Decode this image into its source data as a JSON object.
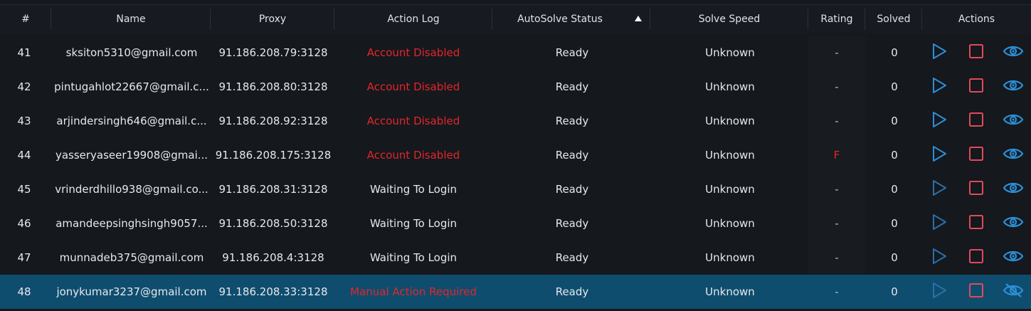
{
  "header": {
    "idx": "#",
    "name": "Name",
    "proxy": "Proxy",
    "action_log": "Action Log",
    "status": "AutoSolve Status",
    "speed": "Solve Speed",
    "rating": "Rating",
    "solved": "Solved",
    "actions": "Actions"
  },
  "colors": {
    "error": "#e3262b",
    "play": "#2a8fd8",
    "stop": "#e04a5a",
    "eye": "#2a8fd8",
    "selected_row": "#0f4d6e"
  },
  "rows": [
    {
      "idx": "41",
      "name": "sksiton5310@gmail.com",
      "proxy": "91.186.208.79:3128",
      "log": "Account Disabled",
      "log_error": true,
      "status": "Ready",
      "speed": "Unknown",
      "rating": "-",
      "solved": "0"
    },
    {
      "idx": "42",
      "name": "pintugahlot22667@gmail.c...",
      "proxy": "91.186.208.80:3128",
      "log": "Account Disabled",
      "log_error": true,
      "status": "Ready",
      "speed": "Unknown",
      "rating": "-",
      "solved": "0"
    },
    {
      "idx": "43",
      "name": "arjindersingh646@gmail.c...",
      "proxy": "91.186.208.92:3128",
      "log": "Account Disabled",
      "log_error": true,
      "status": "Ready",
      "speed": "Unknown",
      "rating": "-",
      "solved": "0"
    },
    {
      "idx": "44",
      "name": "yasseryaseer19908@gmai...",
      "proxy": "91.186.208.175:3128",
      "log": "Account Disabled",
      "log_error": true,
      "status": "Ready",
      "speed": "Unknown",
      "rating": "F",
      "rating_error": true,
      "solved": "0"
    },
    {
      "idx": "45",
      "name": "vrinderdhillo938@gmail.co...",
      "proxy": "91.186.208.31:3128",
      "log": "Waiting To Login",
      "status": "Ready",
      "speed": "Unknown",
      "rating": "-",
      "solved": "0",
      "play_dim": true
    },
    {
      "idx": "46",
      "name": "amandeepsinghsingh9057...",
      "proxy": "91.186.208.50:3128",
      "log": "Waiting To Login",
      "status": "Ready",
      "speed": "Unknown",
      "rating": "-",
      "solved": "0",
      "play_dim": true
    },
    {
      "idx": "47",
      "name": "munnadeb375@gmail.com",
      "proxy": "91.186.208.4:3128",
      "log": "Waiting To Login",
      "status": "Ready",
      "speed": "Unknown",
      "rating": "-",
      "solved": "0",
      "play_dim": true
    },
    {
      "idx": "48",
      "name": "jonykumar3237@gmail.com",
      "proxy": "91.186.208.33:3128",
      "log": "Manual Action Required",
      "log_error": true,
      "status": "Ready",
      "speed": "Unknown",
      "rating": "-",
      "solved": "0",
      "selected": true,
      "play_dim": true,
      "eye_hidden": true
    }
  ]
}
